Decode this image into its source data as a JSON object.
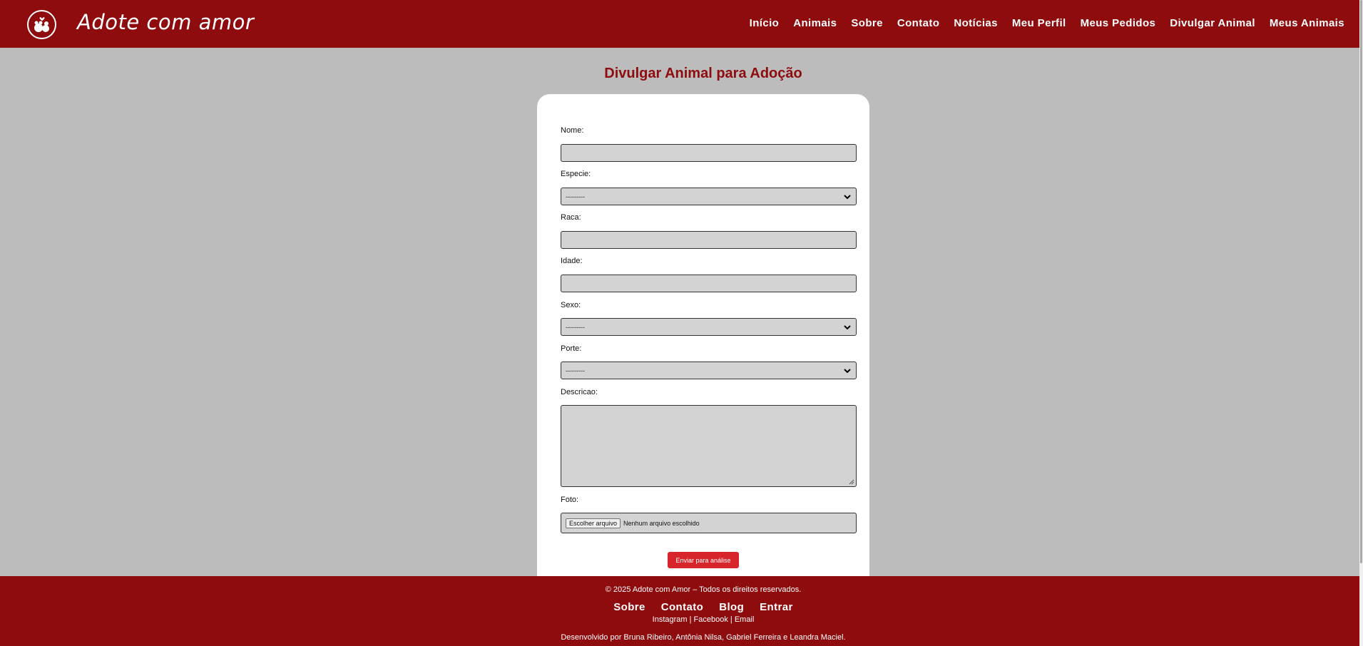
{
  "header": {
    "brand": "Adote com amor",
    "nav": [
      "Início",
      "Animais",
      "Sobre",
      "Contato",
      "Notícias",
      "Meu Perfil",
      "Meus Pedidos",
      "Divulgar Animal",
      "Meus Animais"
    ]
  },
  "main": {
    "title": "Divulgar Animal para Adoção",
    "form": {
      "nome_label": "Nome:",
      "especie_label": "Especie:",
      "especie_value": "---------",
      "raca_label": "Raca:",
      "idade_label": "Idade:",
      "sexo_label": "Sexo:",
      "sexo_value": "---------",
      "porte_label": "Porte:",
      "porte_value": "---------",
      "descricao_label": "Descricao:",
      "foto_label": "Foto:",
      "file_button": "Escolher arquivo",
      "file_status": "Nenhum arquivo escolhido",
      "submit": "Enviar para análise"
    }
  },
  "footer": {
    "copyright": "© 2025 Adote com Amor – Todos os direitos reservados.",
    "links": [
      "Sobre",
      "Contato",
      "Blog",
      "Entrar"
    ],
    "social": "Instagram | Facebook | Email",
    "credits": "Desenvolvido por Bruna Ribeiro, Antônia Nilsa, Gabriel Ferreira e Leandra Maciel."
  },
  "colors": {
    "primary": "#8e0b0e",
    "background": "#bcbcbc",
    "button": "#d7262b",
    "input": "#d3d3d3"
  },
  "icons": {
    "logo": "paw-heart-logo-icon",
    "select": "chevron-down-icon"
  }
}
